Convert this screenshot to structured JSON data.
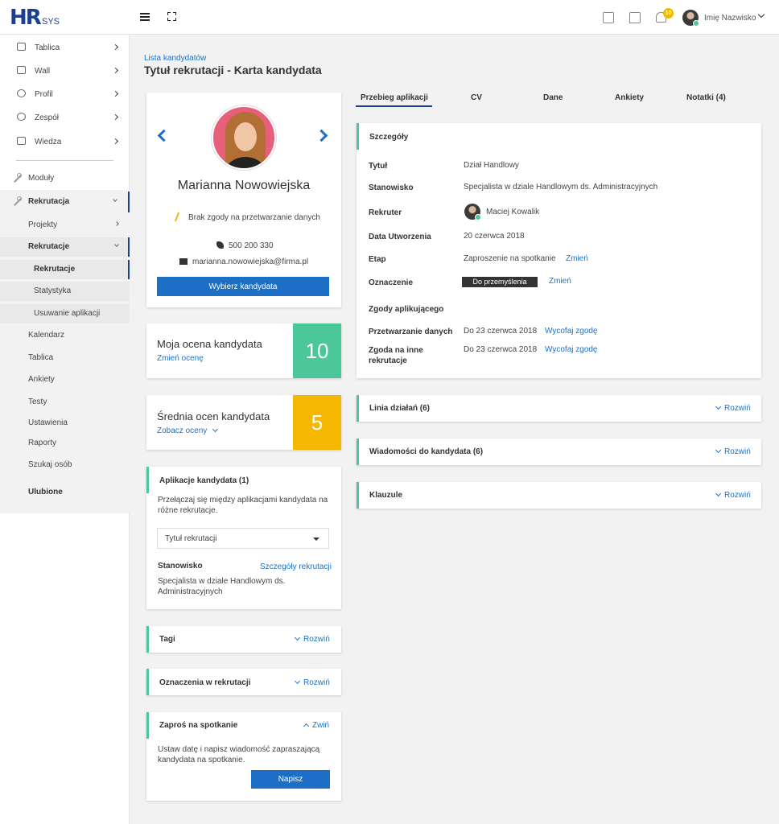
{
  "app": {
    "logo_main": "HR",
    "logo_sub": "SYS"
  },
  "topbar": {
    "notifications_count": "10",
    "user_name": "Imię Nazwisko"
  },
  "sidebar": {
    "items": [
      {
        "label": "Tablica",
        "icon": "monitor-icon"
      },
      {
        "label": "Wall",
        "icon": "wall-icon"
      },
      {
        "label": "Profil",
        "icon": "user-icon"
      },
      {
        "label": "Zespół",
        "icon": "team-icon"
      },
      {
        "label": "Wiedza",
        "icon": "book-icon"
      }
    ],
    "moduly": "Moduły",
    "rekrutacja": "Rekrutacja",
    "sub": {
      "projekty": "Projekty",
      "rekrutacje": "Rekrutacje",
      "rekrutacje_child": "Rekrutacje",
      "statystyka": "Statystyka",
      "usuwanie": "Usuwanie aplikacji",
      "kalendarz": "Kalendarz",
      "tablica": "Tablica",
      "ankiety": "Ankiety",
      "testy": "Testy",
      "ustawienia": "Ustawienia",
      "raporty": "Raporty",
      "szukaj": "Szukaj osób"
    },
    "ulubione": "Ulubione"
  },
  "header": {
    "breadcrumb": "Lista kandydatów",
    "title": "Tytuł rekrutacji - Karta kandydata"
  },
  "candidate": {
    "name": "Marianna Nowowiejska",
    "consent": "Brak zgody na przetwarzanie danych",
    "phone": "500 200 330",
    "email": "marianna.nowowiejska@firma.pl",
    "select_button": "Wybierz kandydata"
  },
  "my_score": {
    "title": "Moja ocena kandydata",
    "link": "Zmień ocenę",
    "value": "10",
    "color": "#4cc79a"
  },
  "avg_score": {
    "title": "Średnia ocen kandydata",
    "link": "Zobacz oceny",
    "value": "5",
    "color": "#f5b800"
  },
  "applications": {
    "title": "Aplikacje kandydata (1)",
    "description": "Przełączaj się między aplikacjami kandydata na różne rekrutacje.",
    "select_value": "Tytuł rekrutacji",
    "position_label": "Stanowisko",
    "details_link": "Szczegóły rekrutacji",
    "position_value": "Specjalista w dziale Handlowym ds. Administracyjnych"
  },
  "panels_left": {
    "tags": "Tagi",
    "marks": "Oznaczenia w rekrutacji",
    "expand": "Rozwiń",
    "invite_title": "Zaproś na spotkanie",
    "collapse": "Zwiń",
    "invite_text": "Ustaw datę i napisz wiadomość zapraszającą kandydata na spotkanie.",
    "invite_button": "Napisz"
  },
  "tabs": [
    "Przebieg aplikacji",
    "CV",
    "Dane",
    "Ankiety",
    "Notatki (4)"
  ],
  "details": {
    "title": "Szczegóły",
    "rows": {
      "tytul_label": "Tytuł",
      "tytul_value": "Dział Handlowy",
      "stanowisko_label": "Stanowisko",
      "stanowisko_value": "Specjalista w dziale Handlowym ds. Administracyjnych",
      "rekruter_label": "Rekruter",
      "rekruter_value": "Maciej Kowalik",
      "data_label": "Data Utworzenia",
      "data_value": "20 czerwca 2018",
      "etap_label": "Etap",
      "etap_value": "Zaproszenie na spotkanie",
      "etap_link": "Zmień",
      "oznaczenie_label": "Oznaczenie",
      "oznaczenie_value": "Do przemyślenia",
      "oznaczenie_link": "Zmień",
      "zgody_label": "Zgody aplikującego",
      "przetw_label": "Przetwarzanie danych",
      "przetw_value": "Do 23 czerwca 2018",
      "przetw_link": "Wycofaj zgodę",
      "inne_label": "Zgoda na inne rekrutacje",
      "inne_value": "Do 23 czerwca 2018",
      "inne_link": "Wycofaj zgodę"
    }
  },
  "panels_right": {
    "linia": "Linia działań (6)",
    "wiadomosci": "Wiadomości do kandydata (6)",
    "klauzule": "Klauzule",
    "expand": "Rozwiń"
  }
}
